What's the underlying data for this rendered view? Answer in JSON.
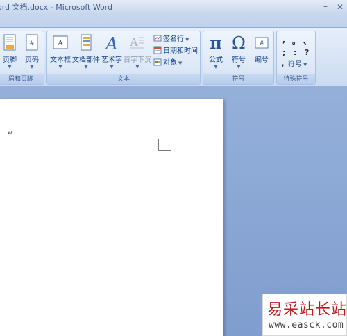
{
  "window": {
    "title": "ord 文档.docx - Microsoft Word",
    "minimize_glyph": "–",
    "close_glyph": "✕"
  },
  "ribbon": {
    "groups": [
      {
        "label": "眉和页脚",
        "buttons": [
          {
            "label": "页脚",
            "icon": "footer-icon"
          },
          {
            "label": "页码",
            "icon": "page-number-icon"
          }
        ]
      },
      {
        "label": "文本",
        "buttons": [
          {
            "label": "文本框",
            "icon": "text-box-icon"
          },
          {
            "label": "文档部件",
            "icon": "quick-parts-icon"
          },
          {
            "label": "艺术字",
            "icon": "wordart-icon"
          },
          {
            "label": "首字下沉",
            "icon": "drop-cap-icon",
            "disabled": true
          }
        ],
        "small_buttons": [
          {
            "label": "签名行",
            "icon": "signature-line-icon",
            "has_arrow": true
          },
          {
            "label": "日期和时间",
            "icon": "date-time-icon",
            "has_arrow": false
          },
          {
            "label": "对象",
            "icon": "object-icon",
            "has_arrow": true
          }
        ]
      },
      {
        "label": "符号",
        "buttons": [
          {
            "label": "公式",
            "icon": "equation-pi-icon",
            "glyph": "π"
          },
          {
            "label": "符号",
            "icon": "symbol-omega-icon",
            "glyph": "Ω"
          },
          {
            "label": "编号",
            "icon": "numbering-icon"
          }
        ]
      },
      {
        "label": "特殊符号",
        "punctuation": [
          ",",
          "。",
          "、",
          ";",
          ":",
          "?"
        ],
        "symbol_button": {
          "label": "符号",
          "glyph": "，"
        }
      }
    ]
  },
  "document": {
    "paragraph_mark": "↵"
  },
  "watermark": {
    "main_text": "易采站长站",
    "url": "www.easck.com"
  }
}
